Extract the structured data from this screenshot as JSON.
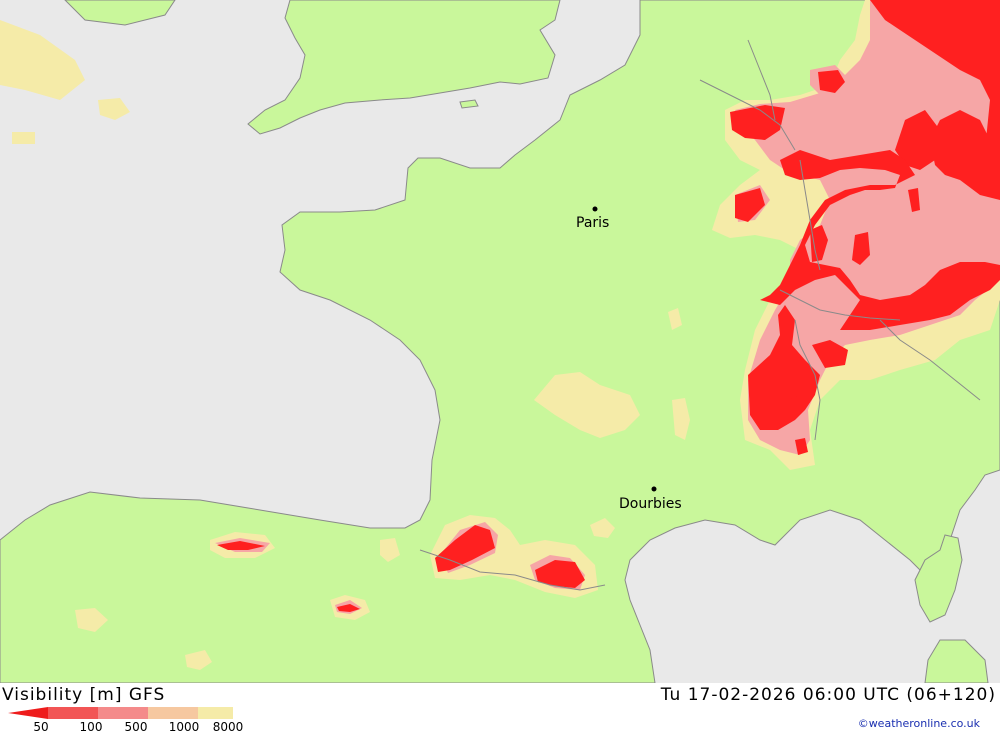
{
  "map": {
    "colors": {
      "sea": "#e9e9e9",
      "land": "#c9f79b",
      "coast": "#888888",
      "vis_8000": "#f5eba8",
      "vis_1000": "#f6a6a6",
      "vis_500": "#f26b6b",
      "vis_100": "#ee3030",
      "vis_50": "#ff0000"
    },
    "cities": [
      {
        "name": "Paris"
      },
      {
        "name": "Dourbies"
      }
    ]
  },
  "footer": {
    "title_left": "Visibility [m] GFS",
    "title_right": "Tu 17-02-2026 06:00 UTC (06+120)",
    "credit": "©weatheronline.co.uk",
    "legend_labels": [
      "50",
      "100",
      "500",
      "1000",
      "8000"
    ],
    "legend_colors": [
      "#ee1c1c",
      "#f25555",
      "#f48a8a",
      "#f6c8a0",
      "#f5eba8"
    ]
  }
}
